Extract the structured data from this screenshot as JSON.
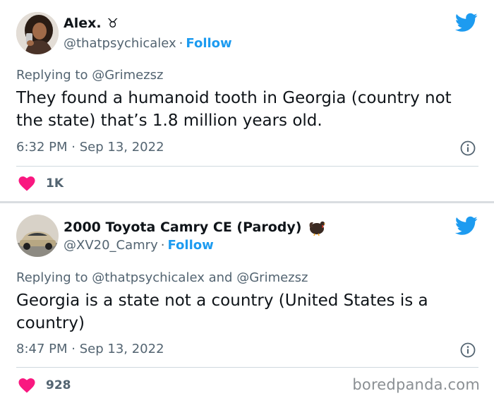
{
  "tweets": [
    {
      "display_name": "Alex.",
      "name_emoji": "♉",
      "handle": "@thatpsychicalex",
      "separator": "·",
      "follow_label": "Follow",
      "replying_prefix": "Replying to",
      "replying_to": "@Grimezsz",
      "replying_joiner": "",
      "replying_to_2": "",
      "text": "They found a humanoid tooth in Georgia (country not the state) that’s 1.8 million years old.",
      "time": "6:32 PM",
      "date": "Sep 13, 2022",
      "likes": "1K",
      "icons": [
        "avatar",
        "twitter-bird-icon",
        "info-icon",
        "heart-icon"
      ]
    },
    {
      "display_name": "2000 Toyota Camry CE (Parody)",
      "name_emoji": "turkey",
      "handle": "@XV20_Camry",
      "separator": "·",
      "follow_label": "Follow",
      "replying_prefix": "Replying to",
      "replying_to": "@thatpsychicalex",
      "replying_joiner": "and",
      "replying_to_2": "@Grimezsz",
      "text": "Georgia is a state not a country (United States is a country)",
      "time": "8:47 PM",
      "date": "Sep 13, 2022",
      "likes": "928",
      "icons": [
        "avatar",
        "twitter-bird-icon",
        "info-icon",
        "heart-icon"
      ]
    }
  ],
  "watermark": "boredpanda.com",
  "colors": {
    "twitter_blue": "#1d9bf0",
    "secondary_text": "#536471",
    "heart_pink": "#f91880",
    "primary_text": "#0f1419"
  }
}
